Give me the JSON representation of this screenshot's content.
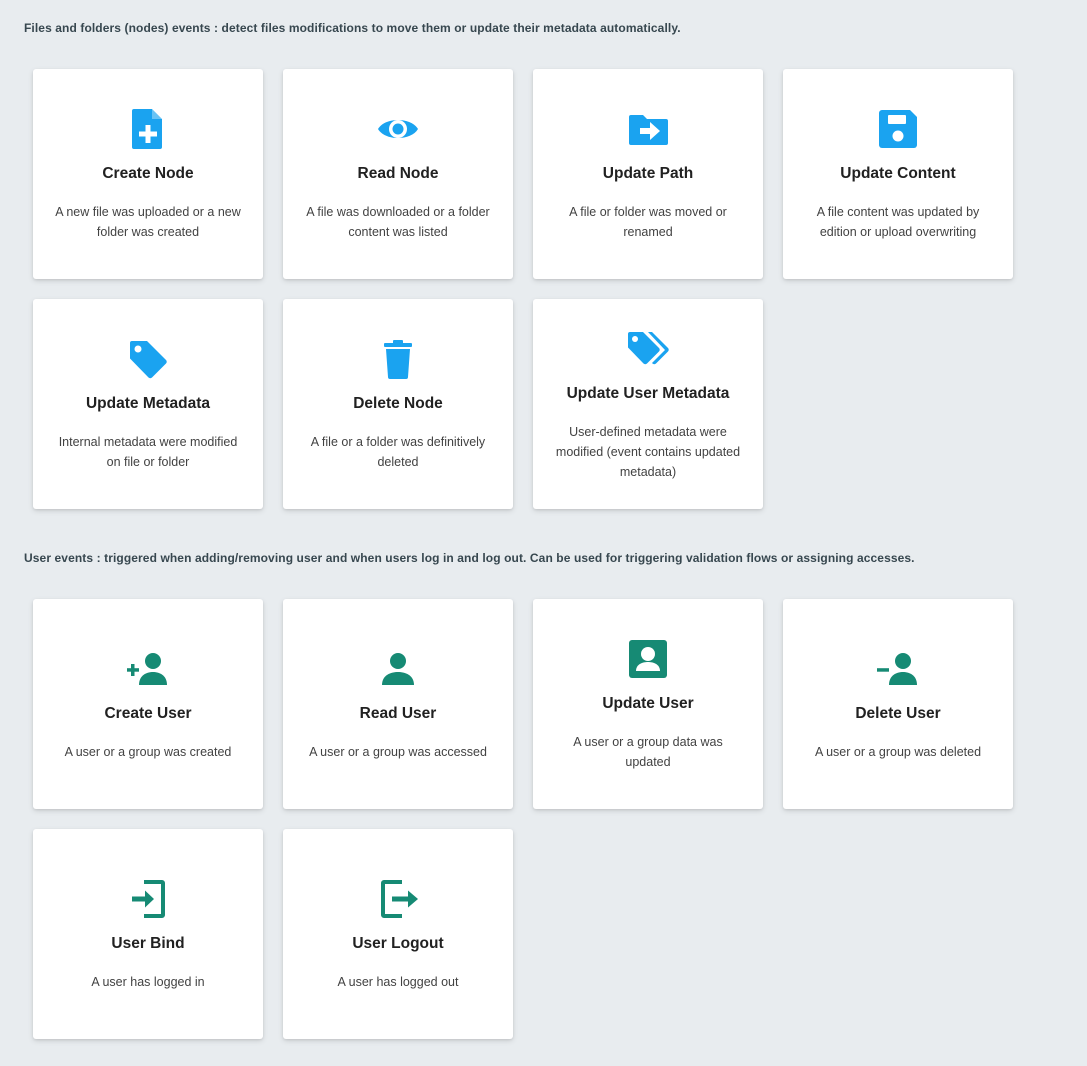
{
  "sections": [
    {
      "description": "Files and folders (nodes) events : detect files modifications to move them or update their metadata automatically.",
      "cards": [
        {
          "icon": "file-plus-icon",
          "title": "Create Node",
          "desc": "A new file was uploaded or a new folder was created"
        },
        {
          "icon": "eye-icon",
          "title": "Read Node",
          "desc": "A file was downloaded or a folder content was listed"
        },
        {
          "icon": "folder-move-icon",
          "title": "Update Path",
          "desc": "A file or folder was moved or renamed"
        },
        {
          "icon": "floppy-disk-icon",
          "title": "Update Content",
          "desc": "A file content was updated by edition or upload overwriting"
        },
        {
          "icon": "tag-icon",
          "title": "Update Metadata",
          "desc": "Internal metadata were modified on file or folder"
        },
        {
          "icon": "trash-icon",
          "title": "Delete Node",
          "desc": "A file or a folder was definitively deleted"
        },
        {
          "icon": "tags-icon",
          "title": "Update User Metadata",
          "desc": "User-defined metadata were modified (event contains updated metadata)"
        }
      ]
    },
    {
      "description": "User events : triggered when adding/removing user and when users log in and log out. Can be used for triggering validation flows or assigning accesses.",
      "cards": [
        {
          "icon": "user-plus-icon",
          "title": "Create User",
          "desc": "A user or a group was created"
        },
        {
          "icon": "user-icon",
          "title": "Read User",
          "desc": "A user or a group was accessed"
        },
        {
          "icon": "account-box-icon",
          "title": "Update User",
          "desc": "A user or a group data was updated"
        },
        {
          "icon": "user-minus-icon",
          "title": "Delete User",
          "desc": "A user or a group was deleted"
        },
        {
          "icon": "login-icon",
          "title": "User Bind",
          "desc": "A user has logged in"
        },
        {
          "icon": "logout-icon",
          "title": "User Logout",
          "desc": "A user has logged out"
        }
      ]
    }
  ],
  "colors": {
    "node_icon": "#1aa3f0",
    "user_icon": "#168a74"
  }
}
